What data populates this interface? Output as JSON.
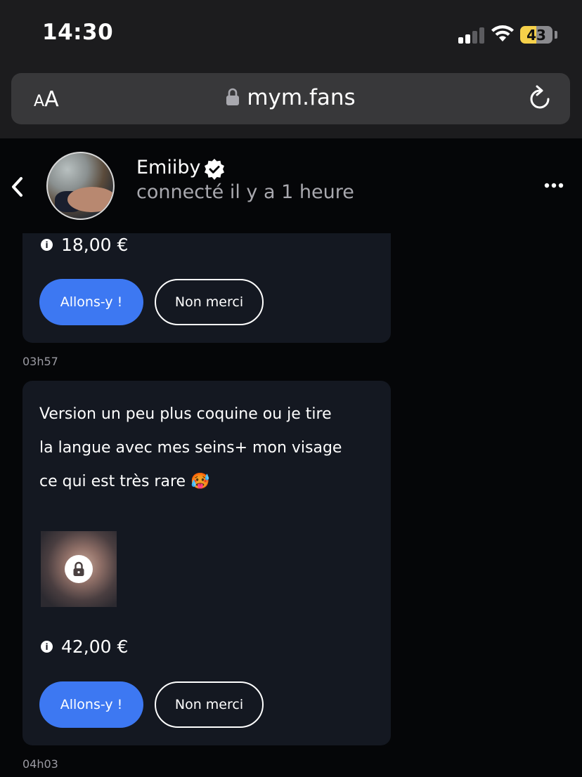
{
  "status_bar": {
    "time": "14:30",
    "battery": "43"
  },
  "browser": {
    "reader_label_small": "A",
    "reader_label_large": "A",
    "url": "mym.fans"
  },
  "chat_header": {
    "name": "Emiiby",
    "status": "connecté il y a 1 heure"
  },
  "messages": [
    {
      "price": "18,00 €",
      "accept_label": "Allons-y !",
      "decline_label": "Non merci",
      "time": "03h57"
    },
    {
      "text": "Version un peu plus coquine ou je tire\nla langue avec mes seins+ mon visage\nce qui est très rare 🥵",
      "price": "42,00 €",
      "accept_label": "Allons-y !",
      "decline_label": "Non merci",
      "time": "04h03"
    }
  ],
  "colors": {
    "accent": "#3d78f2",
    "bubble": "#141821",
    "background": "#050608",
    "battery": "#f5d04a"
  }
}
